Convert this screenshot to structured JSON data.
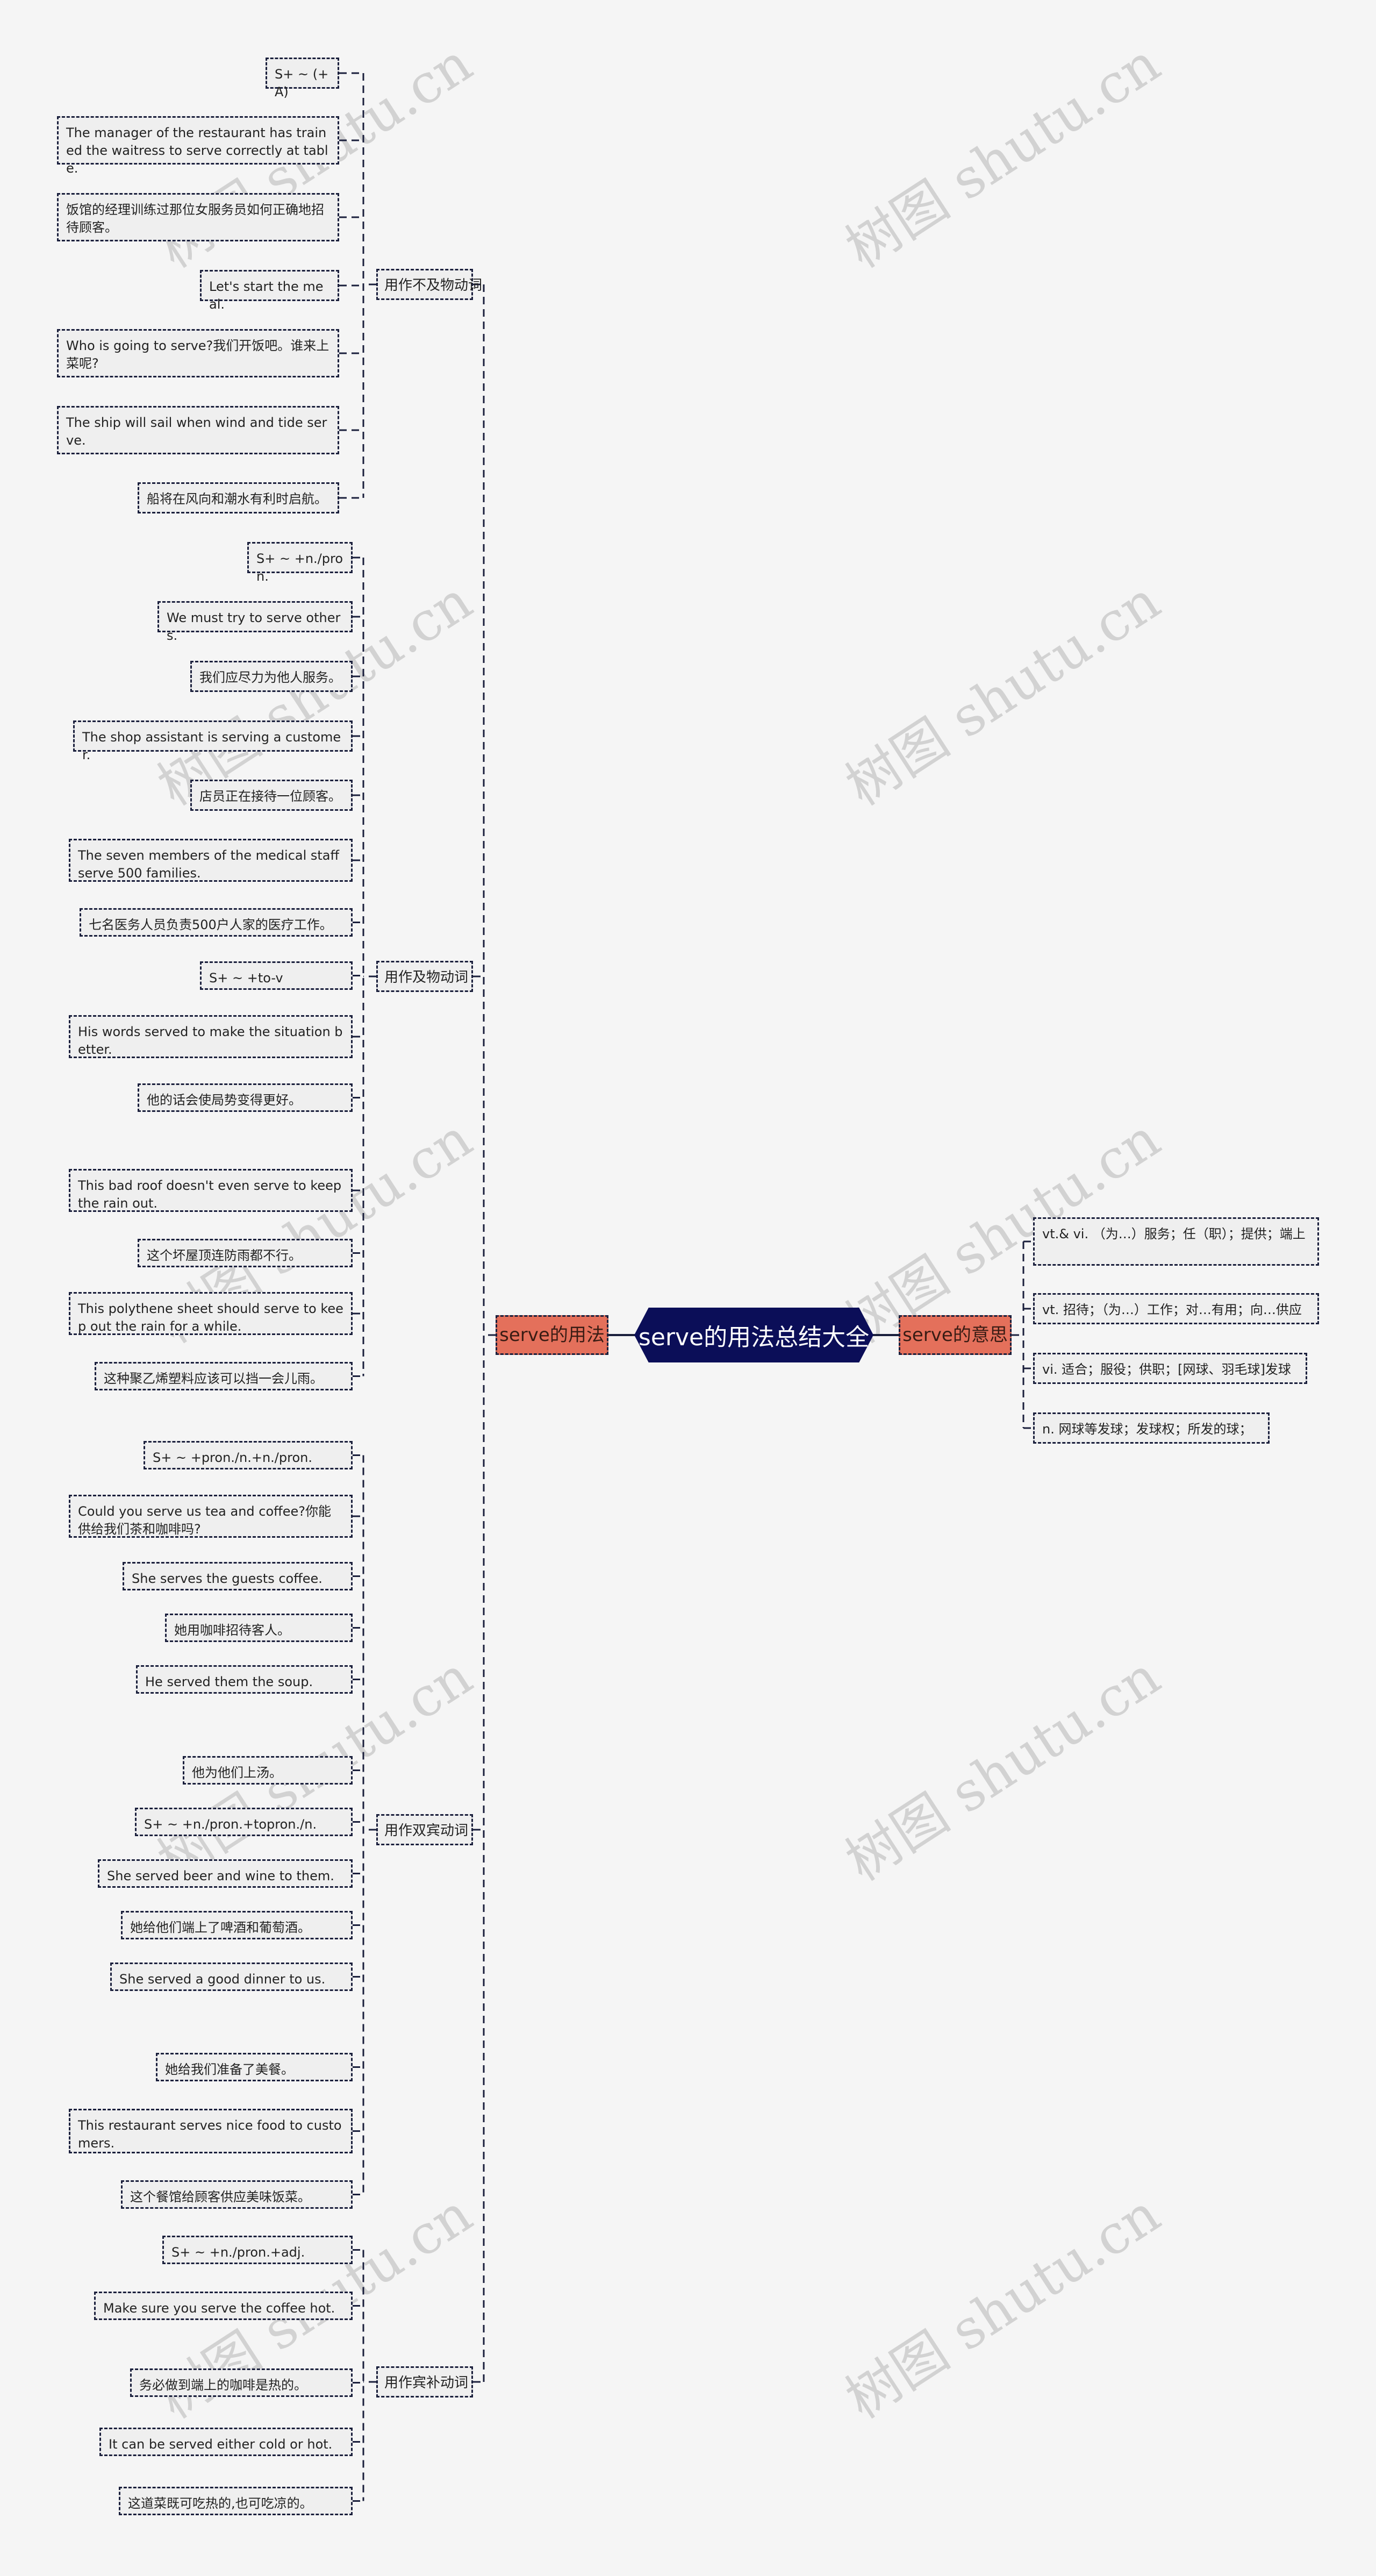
{
  "root": {
    "label": "serve的用法总结大全"
  },
  "watermark": "树图 shutu.cn",
  "colors": {
    "root_bg": "#0b0e58",
    "branch_bg": "#e4705b",
    "node_border": "#1a1f3c",
    "background": "#f5f5f5"
  },
  "left_branch": {
    "label": "serve的用法",
    "categories": [
      {
        "label": "用作不及物动词",
        "items": [
          "S+ ~ (+A)",
          "The manager of the restaurant has trained the waitress to serve correctly at table.",
          "饭馆的经理训练过那位女服务员如何正确地招待顾客。",
          "Let's start the meal.",
          "Who is going to serve?我们开饭吧。谁来上菜呢?",
          "The ship will sail when wind and tide serve.",
          "船将在风向和潮水有利时启航。"
        ]
      },
      {
        "label": "用作及物动词",
        "items": [
          "S+ ~ +n./pron.",
          "We must try to serve others.",
          "我们应尽力为他人服务。",
          "The shop assistant is serving a customer.",
          "店员正在接待一位顾客。",
          "The seven members of the medical staff serve 500 families.",
          "七名医务人员负责500户人家的医疗工作。",
          "S+ ~ +to-v",
          "His words served to make the situation better.",
          "他的话会使局势变得更好。",
          "This bad roof doesn't even serve to keep the rain out.",
          "这个坏屋顶连防雨都不行。",
          "This polythene sheet should serve to keep out the rain for a while.",
          "这种聚乙烯塑料应该可以挡一会儿雨。"
        ]
      },
      {
        "label": "用作双宾动词",
        "items": [
          "S+ ~ +pron./n.+n./pron.",
          "Could you serve us tea and coffee?你能供给我们茶和咖啡吗?",
          "She serves the guests coffee.",
          "她用咖啡招待客人。",
          "He served them the soup.",
          "他为他们上汤。",
          "S+ ~ +n./pron.+topron./n.",
          "She served beer and wine to them.",
          "她给他们端上了啤酒和葡萄酒。",
          "She served a good dinner to us.",
          "她给我们准备了美餐。",
          "This restaurant serves nice food to customers.",
          "这个餐馆给顾客供应美味饭菜。"
        ]
      },
      {
        "label": "用作宾补动词",
        "items": [
          "S+ ~ +n./pron.+adj.",
          "Make sure you serve the coffee hot.",
          "务必做到端上的咖啡是热的。",
          "It can be served either cold or hot.",
          "这道菜既可吃热的,也可吃凉的。"
        ]
      }
    ]
  },
  "right_branch": {
    "label": "serve的意思",
    "items": [
      "vt.& vi. （为…）服务；任（职）；提供；端上",
      "vt. 招待；（为…）工作；对…有用；向…供应",
      "vi. 适合；服役；供职；[网球、羽毛球]发球",
      "n. 网球等发球；发球权；所发的球；"
    ]
  }
}
